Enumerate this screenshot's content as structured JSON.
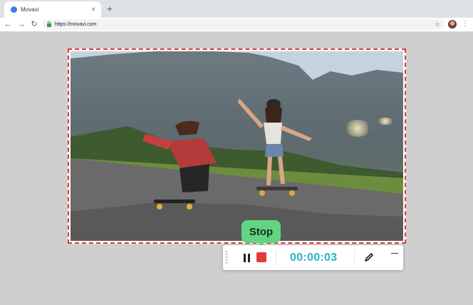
{
  "browser": {
    "tab": {
      "title": "Movavi",
      "close_glyph": "×",
      "favicon": "movavi-favicon"
    },
    "new_tab_glyph": "+",
    "nav": {
      "back": "←",
      "forward": "→",
      "reload": "↻"
    },
    "address_bar": {
      "url": "https://movavi.com",
      "secure_icon": "lock-icon"
    },
    "bookmark_glyph": "☆",
    "menu_glyph": "⋮"
  },
  "recording": {
    "frame_color": "#e03a3a",
    "tooltip": "Stop",
    "tooltip_color": "#63d482",
    "timer": "00:00:03",
    "timer_color": "#29b7c7",
    "stop_color": "#e33b3b",
    "icons": [
      "drag-handle-icon",
      "pause-icon",
      "stop-icon",
      "pen-icon",
      "minimize-icon"
    ]
  }
}
